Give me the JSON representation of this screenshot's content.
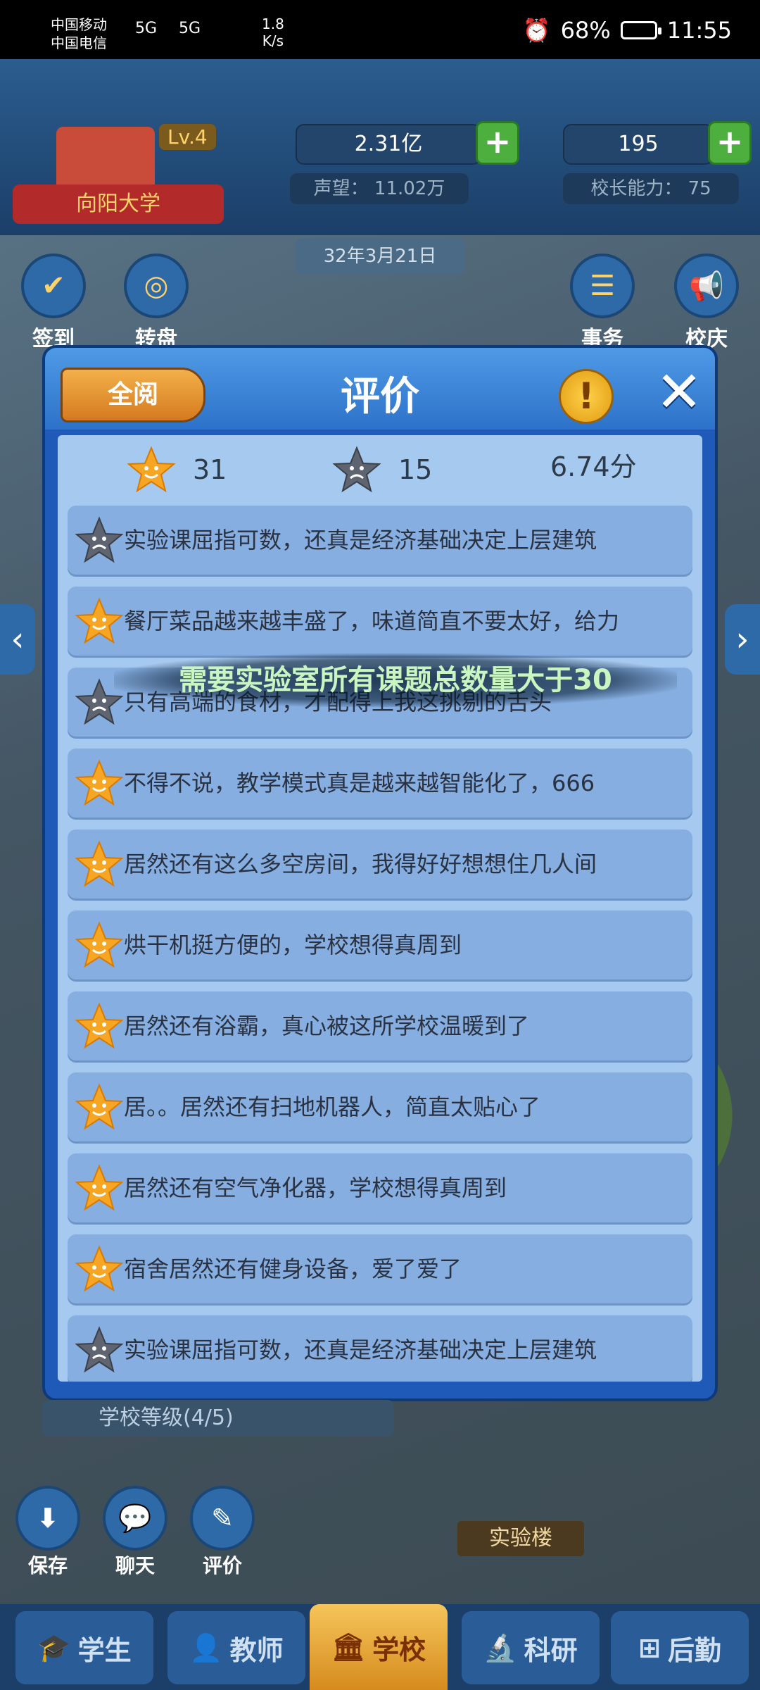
{
  "status_bar": {
    "carrier1": "中国移动",
    "carrier2": "中国电信",
    "net1": "5G",
    "net2": "5G",
    "speed_value": "1.8",
    "speed_unit": "K/s",
    "battery": "68%",
    "time": "11:55"
  },
  "header": {
    "school_name": "向阳大学",
    "level": "Lv.4",
    "money": "2.31亿",
    "gems": "195",
    "reputation": "声望： 11.02万",
    "principal_ability": "校长能力： 75",
    "date": "32年3月21日"
  },
  "side_buttons": {
    "checkin": "签到",
    "wheel": "转盘",
    "affairs": "事务",
    "anniversary": "校庆"
  },
  "modal": {
    "back_label": "全阅",
    "title": "评价",
    "info_symbol": "!",
    "close_symbol": "✕",
    "summary": {
      "good_count": "31",
      "bad_count": "15",
      "score": "6.74分"
    },
    "tooltip": "需要实验室所有课题总数量大于30",
    "reviews": [
      {
        "sentiment": "negative",
        "text": "实验课屈指可数，还真是经济基础决定上层建筑"
      },
      {
        "sentiment": "positive",
        "text": "餐厅菜品越来越丰盛了，味道简直不要太好，给力"
      },
      {
        "sentiment": "negative",
        "text": "只有高端的食材，才配得上我这挑剔的舌头"
      },
      {
        "sentiment": "positive",
        "text": "不得不说，教学模式真是越来越智能化了，666"
      },
      {
        "sentiment": "positive",
        "text": "居然还有这么多空房间，我得好好想想住几人间"
      },
      {
        "sentiment": "positive",
        "text": "烘干机挺方便的，学校想得真周到"
      },
      {
        "sentiment": "positive",
        "text": "居然还有浴霸，真心被这所学校温暖到了"
      },
      {
        "sentiment": "positive",
        "text": "居。。居然还有扫地机器人，简直太贴心了"
      },
      {
        "sentiment": "positive",
        "text": "居然还有空气净化器，学校想得真周到"
      },
      {
        "sentiment": "positive",
        "text": "宿舍居然还有健身设备，爱了爱了"
      },
      {
        "sentiment": "negative",
        "text": "实验课屈指可数，还真是经济基础决定上层建筑"
      }
    ]
  },
  "bottom": {
    "school_level": "学校等级(4/5)",
    "save": "保存",
    "chat": "聊天",
    "review": "评价",
    "lab_building": "实验楼"
  },
  "nav": {
    "students": "学生",
    "teachers": "教师",
    "school": "学校",
    "research": "科研",
    "logistics": "后勤"
  },
  "colors": {
    "positive_star": "#f6a623",
    "negative_star": "#5e6470",
    "modal_blue": "#2d72c9",
    "list_bg": "#a6c9ef",
    "row_bg": "#86aee0"
  }
}
